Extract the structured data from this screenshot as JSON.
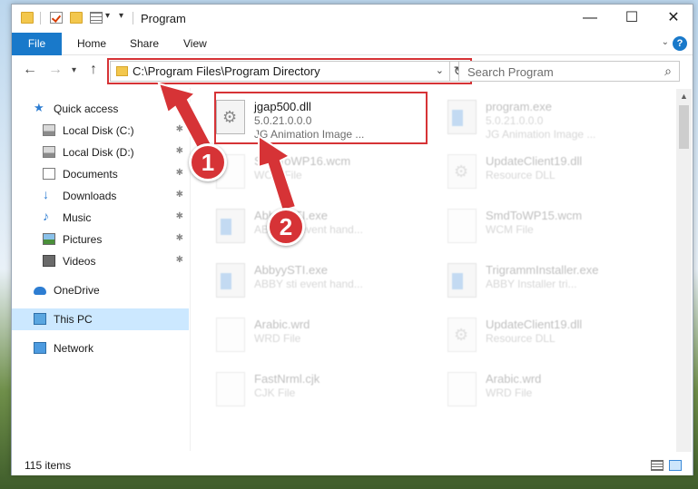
{
  "window": {
    "title": "Program",
    "controls": {
      "minimize": "—",
      "maximize": "☐",
      "close": "✕"
    }
  },
  "ribbon": {
    "tabs": [
      "File",
      "Home",
      "Share",
      "View"
    ],
    "help": "?"
  },
  "nav": {
    "address": "C:\\Program Files\\Program Directory",
    "search_placeholder": "Search Program"
  },
  "sidebar": {
    "items": [
      {
        "label": "Quick access",
        "icon": "star-icon"
      },
      {
        "label": "Local Disk (C:)",
        "icon": "disk-icon",
        "pinned": true
      },
      {
        "label": "Local Disk (D:)",
        "icon": "disk-icon",
        "pinned": true
      },
      {
        "label": "Documents",
        "icon": "documents-icon",
        "pinned": true
      },
      {
        "label": "Downloads",
        "icon": "download-icon",
        "pinned": true
      },
      {
        "label": "Music",
        "icon": "music-icon",
        "pinned": true
      },
      {
        "label": "Pictures",
        "icon": "pictures-icon",
        "pinned": true
      },
      {
        "label": "Videos",
        "icon": "videos-icon",
        "pinned": true
      },
      {
        "label": "OneDrive",
        "icon": "cloud-icon"
      },
      {
        "label": "This PC",
        "icon": "pc-icon",
        "selected": true
      },
      {
        "label": "Network",
        "icon": "network-icon"
      }
    ]
  },
  "files": [
    {
      "name": "jgap500.dll",
      "line1": "5.0.21.0.0.0",
      "line2": "JG Animation Image ...",
      "type": "dll",
      "highlighted": true
    },
    {
      "name": "program.exe",
      "line1": "5.0.21.0.0.0",
      "line2": "JG Animation Image ...",
      "type": "exe"
    },
    {
      "name": "SmdToWP16.wcm",
      "line1": "WCM File",
      "line2": "",
      "type": "doc"
    },
    {
      "name": "UpdateClient19.dll",
      "line1": "Resource DLL",
      "line2": "",
      "type": "dll"
    },
    {
      "name": "AbbyySTI.exe",
      "line1": "ABBY sti event hand...",
      "line2": "",
      "type": "exe"
    },
    {
      "name": "SmdToWP15.wcm",
      "line1": "WCM File",
      "line2": "",
      "type": "doc"
    },
    {
      "name": "AbbyySTI.exe",
      "line1": "ABBY sti event hand...",
      "line2": "",
      "type": "exe"
    },
    {
      "name": "TrigrammInstaller.exe",
      "line1": "ABBY Installer tri...",
      "line2": "",
      "type": "exe"
    },
    {
      "name": "Arabic.wrd",
      "line1": "WRD File",
      "line2": "",
      "type": "doc"
    },
    {
      "name": "UpdateClient19.dll",
      "line1": "Resource DLL",
      "line2": "",
      "type": "dll"
    },
    {
      "name": "FastNrml.cjk",
      "line1": "CJK File",
      "line2": "",
      "type": "doc"
    },
    {
      "name": "Arabic.wrd",
      "line1": "WRD File",
      "line2": "",
      "type": "doc"
    }
  ],
  "status": {
    "count": "115 items"
  },
  "annotations": {
    "step1": "1",
    "step2": "2"
  },
  "colors": {
    "accent": "#1979ca",
    "annotation": "#d63336",
    "selected_bg": "#cce8ff"
  }
}
